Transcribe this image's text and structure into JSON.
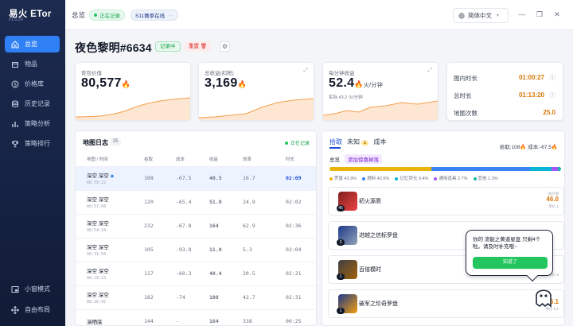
{
  "app": {
    "name": "易火 ETor",
    "version": "v1.0.29"
  },
  "nav": [
    {
      "label": "总览",
      "icon": "home-icon",
      "active": true
    },
    {
      "label": "物品",
      "icon": "box-icon"
    },
    {
      "label": "价格库",
      "icon": "dollar-icon"
    },
    {
      "label": "历史记录",
      "icon": "database-icon"
    },
    {
      "label": "策略分析",
      "icon": "chart-icon"
    },
    {
      "label": "策略排行",
      "icon": "trophy-icon"
    }
  ],
  "nav_bottom": [
    {
      "label": "小窗模式",
      "icon": "mini-window-icon"
    },
    {
      "label": "自由布局",
      "icon": "move-icon"
    }
  ],
  "topbar": {
    "title": "总览",
    "status": "正在记录",
    "season": "S11赛季在线",
    "season_more": "···",
    "lang": "简体中文"
  },
  "page": {
    "title": "夜色黎明#6634",
    "rec_badge": "记录中",
    "reset": "重置"
  },
  "cards": {
    "bag": {
      "label": "背包价值",
      "value": "80,577"
    },
    "income": {
      "label": "总收益(扣税)",
      "value": "3,169"
    },
    "per_min": {
      "label": "每分钟收益",
      "value": "52.4",
      "unit": "火/分钟",
      "sub": "实际 43.2 火/分钟"
    }
  },
  "timers": [
    {
      "label": "图内时长",
      "value": "01:00:27"
    },
    {
      "label": "总时长",
      "value": "01:13:20"
    },
    {
      "label": "地图次数",
      "value": "25.0"
    }
  ],
  "log": {
    "title": "地图日志",
    "count": "25",
    "live": "正在记录",
    "headers": [
      "地图 / 时间",
      "拾取",
      "成本",
      "收益",
      "效率",
      "时长"
    ],
    "rows": [
      {
        "map": "深空 深空",
        "time": "08:59:22",
        "pick": "108",
        "cost": "-67.5",
        "inc": "40.5",
        "eff": "16.7",
        "dur": "02:09",
        "selected": true
      },
      {
        "map": "深空 深空",
        "time": "08:57:08",
        "pick": "120",
        "cost": "-65.4",
        "inc": "51.0",
        "eff": "24.9",
        "dur": "02:02"
      },
      {
        "map": "深空 深空",
        "time": "08:54:34",
        "pick": "232",
        "cost": "-67.8",
        "inc": "164",
        "eff": "62.9",
        "dur": "02:36"
      },
      {
        "map": "深空 深空",
        "time": "08:31:58",
        "pick": "105",
        "cost": "-93.8",
        "inc": "11.0",
        "eff": "5.3",
        "dur": "02:04"
      },
      {
        "map": "深空 深空",
        "time": "08:29:23",
        "pick": "117",
        "cost": "-60.3",
        "inc": "48.4",
        "eff": "20.5",
        "dur": "02:21"
      },
      {
        "map": "深空 深空",
        "time": "08:26:42",
        "pick": "182",
        "cost": "-74",
        "inc": "108",
        "eff": "42.7",
        "dur": "02:31"
      },
      {
        "map": "湍栖底",
        "time": "",
        "pick": "144",
        "cost": "-",
        "inc": "164",
        "eff": "338",
        "dur": "00:25"
      }
    ]
  },
  "drops": {
    "tabs": [
      "拾取",
      "未知",
      "成本"
    ],
    "unknown_badge": "1",
    "stat": "拾取:108🔥   成本:-67.5🔥",
    "chips": [
      "总览",
      "添加惊喜掉落"
    ],
    "legend": [
      {
        "label": "罗盘",
        "pct": "43.9%",
        "color": "#eab308"
      },
      {
        "label": "燃料",
        "pct": "42.6%",
        "color": "#3b82f6"
      },
      {
        "label": "记忆荧光",
        "pct": "9.4%",
        "color": "#06b6d4"
      },
      {
        "label": "通用道具",
        "pct": "2.7%",
        "color": "#a855f7"
      },
      {
        "label": "其他",
        "pct": "1.3%",
        "color": "#14b8a6"
      }
    ],
    "items": [
      {
        "name": "初火源质",
        "count": "46",
        "price": "46.0",
        "label": "总价值",
        "meta": "单价 1"
      },
      {
        "name": "进越之信标罗盘",
        "count": "3",
        "price": "",
        "label": "",
        "meta": ""
      },
      {
        "name": "百倍模时",
        "count": "1",
        "price": "",
        "label": "",
        "meta": "单价 9"
      },
      {
        "name": "破军之珍奇罗盘",
        "count": "1",
        "price": "6.1",
        "label": "",
        "meta": "单价 6.1"
      }
    ]
  },
  "tip": {
    "msg": "你的 流能之黄道星盘 只剩4个啦，请及时补充哦~",
    "ok": "知道了"
  }
}
